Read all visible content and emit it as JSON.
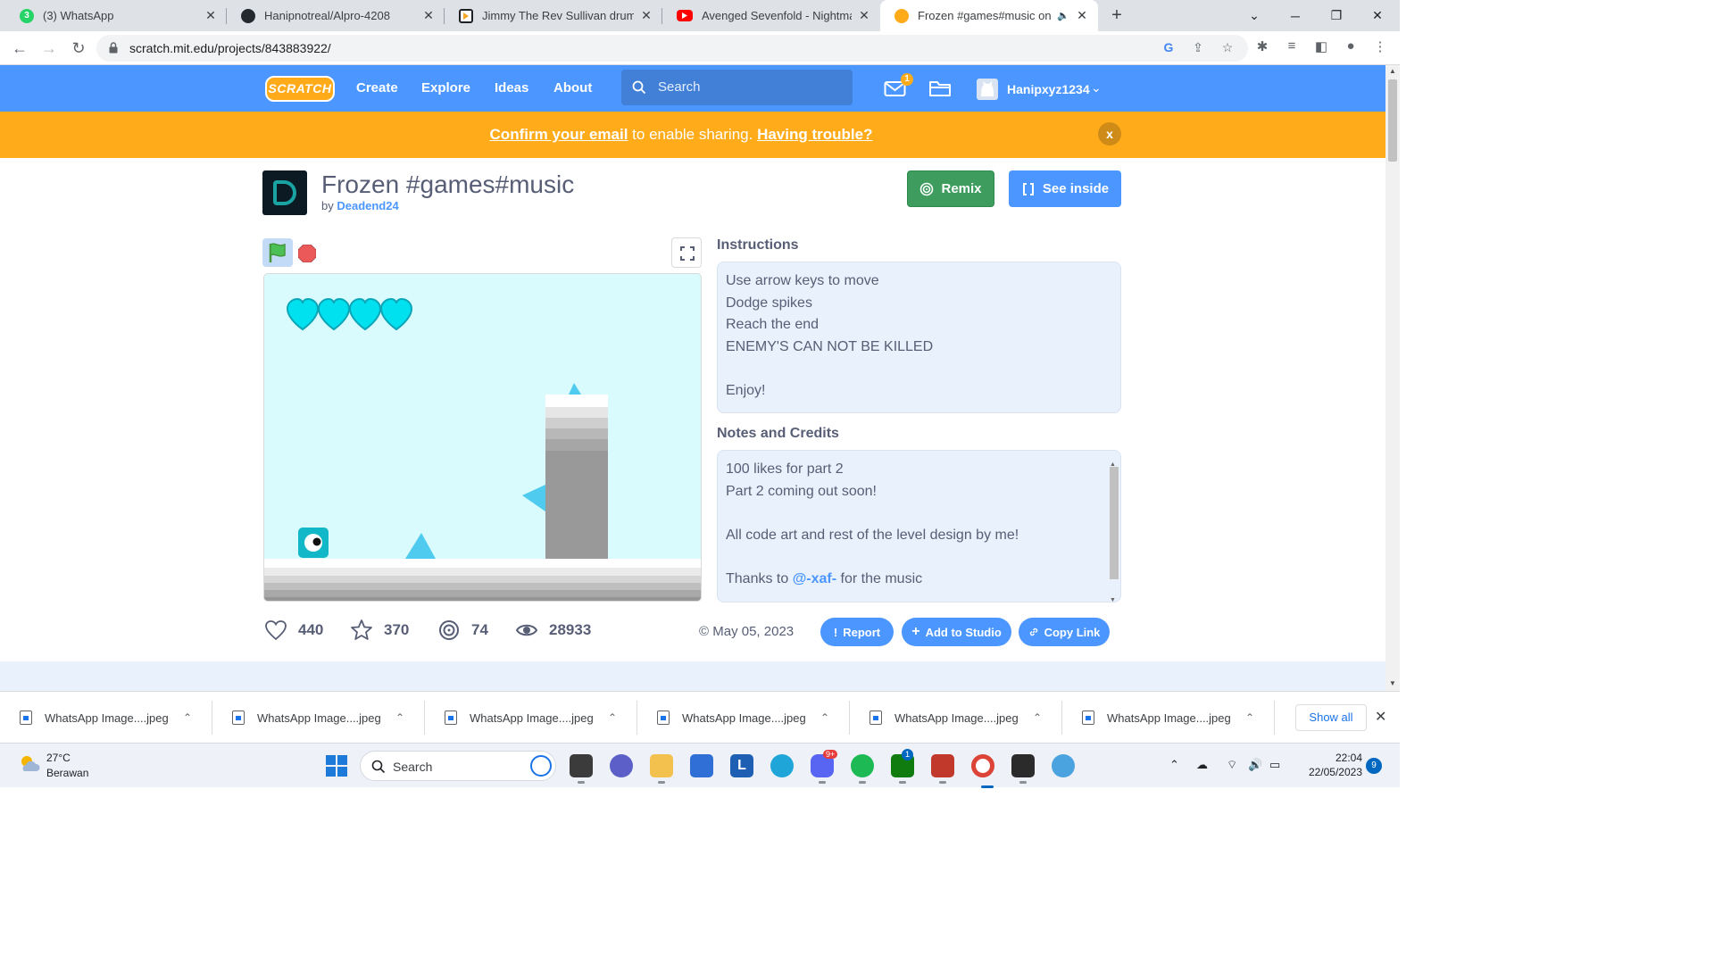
{
  "browser": {
    "tabs": [
      {
        "title": "(3) WhatsApp",
        "icon": "whatsapp-icon"
      },
      {
        "title": "Hanipnotreal/Alpro-4208",
        "icon": "github-icon"
      },
      {
        "title": "Jimmy The Rev Sullivan drums | A",
        "icon": "video-icon"
      },
      {
        "title": "Avenged Sevenfold - Nightmare",
        "icon": "youtube-icon"
      },
      {
        "title": "Frozen #games#music on Sc",
        "icon": "scratch-icon",
        "active": true
      }
    ],
    "whatsapp_badge": "3",
    "url": "scratch.mit.edu/projects/843883922/"
  },
  "scratch_nav": {
    "logo": "SCRATCH",
    "links": [
      "Create",
      "Explore",
      "Ideas",
      "About"
    ],
    "search_placeholder": "Search",
    "message_count": "1",
    "username": "Hanipxyz1234"
  },
  "banner": {
    "confirm_link": "Confirm your email",
    "middle_text": " to enable sharing. ",
    "trouble_link": "Having trouble?",
    "close_label": "x"
  },
  "project": {
    "title": "Frozen #games#music",
    "by_label": "by ",
    "author": "Deadend24",
    "remix_label": "Remix",
    "see_inside_label": "See inside",
    "lives": 4,
    "stats": {
      "loves": "440",
      "favorites": "370",
      "remixes": "74",
      "views": "28933"
    },
    "date": "May 05, 2023",
    "date_icon": "©",
    "report_label": "Report",
    "add_to_studio_label": "Add to Studio",
    "copy_link_label": "Copy Link",
    "instructions_heading": "Instructions",
    "instructions": [
      "Use arrow keys to move",
      "Dodge spikes",
      "Reach the end",
      "ENEMY'S CAN NOT BE KILLED",
      "",
      "Enjoy!"
    ],
    "notes_heading": "Notes and Credits",
    "notes": [
      "100 likes for part 2",
      "Part 2 coming out soon!",
      "",
      "All code art and rest of the level design by me!",
      ""
    ],
    "notes_thanks_prefix": "Thanks to ",
    "notes_thanks_mention": "@-xaf-",
    "notes_thanks_suffix": " for the music"
  },
  "downloads": {
    "items": [
      "WhatsApp Image....jpeg",
      "WhatsApp Image....jpeg",
      "WhatsApp Image....jpeg",
      "WhatsApp Image....jpeg",
      "WhatsApp Image....jpeg",
      "WhatsApp Image....jpeg"
    ],
    "show_all_label": "Show all"
  },
  "taskbar": {
    "temperature": "27°C",
    "condition": "Berawan",
    "search_label": "Search",
    "discord_badge": "9+",
    "xbox_badge": "1",
    "time": "22:04",
    "date": "22/05/2023",
    "notification_count": "9"
  },
  "colors": {
    "scratch_blue": "#4c97ff",
    "banner_orange": "#ffab1a",
    "remix_green": "#3d9c5e",
    "stage_sky": "#d9fbfd",
    "heart_cyan": "#00e1f0"
  }
}
